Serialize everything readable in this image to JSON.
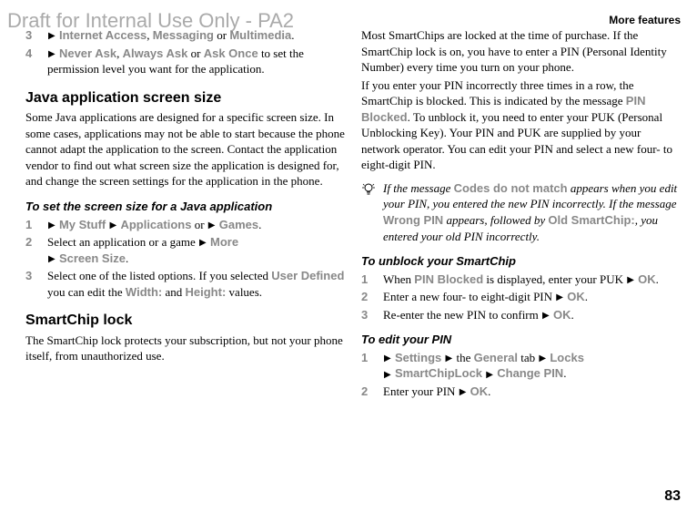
{
  "watermark": "Draft for Internal Use Only - PA2",
  "headerRight": "More features",
  "pageNum": "83",
  "left": {
    "step3num": "3",
    "step3_arrow": "▶",
    "step3_t1": "Internet Access",
    "step3_sep1": ", ",
    "step3_t2": "Messaging",
    "step3_sep2": " or ",
    "step3_t3": "Multimedia",
    "step3_end": ".",
    "step4num": "4",
    "step4_t1": "Never Ask",
    "step4_sep1": ", ",
    "step4_t2": "Always Ask",
    "step4_sep2": " or ",
    "step4_t3": "Ask Once",
    "step4_body": " to set the permission level you want for the application.",
    "h_java": "Java application screen size",
    "p_java": "Some Java applications are designed for a specific screen size. In some cases, applications may not be able to start because the phone cannot adapt the application to the screen. Contact the application vendor to find out what screen size the application is designed for, and change the screen settings for the application in the phone.",
    "h_setscreen": "To set the screen size for a Java application",
    "ss1num": "1",
    "ss1_t1": "My Stuff",
    "ss1_t2": "Applications",
    "ss1_sep": " or ",
    "ss1_t3": "Games",
    "ss1_end": ".",
    "ss2num": "2",
    "ss2_body1": "Select an application or a game ",
    "ss2_t1": "More",
    "ss2_t2": "Screen Size",
    "ss2_end": ".",
    "ss3num": "3",
    "ss3_body1": "Select one of the listed options. If you selected ",
    "ss3_t1": "User Defined",
    "ss3_body2": " you can edit the ",
    "ss3_t2": "Width:",
    "ss3_body3": " and ",
    "ss3_t3": "Height:",
    "ss3_body4": " values.",
    "h_smartchip": "SmartChip lock",
    "p_smartchip": "The SmartChip lock protects your subscription, but not your phone itself, from unauthorized use."
  },
  "right": {
    "p1a": "Most SmartChips are locked at the time of purchase. If the SmartChip lock is on, you have to enter a PIN (Personal Identity Number) every time you turn on your phone.",
    "p1b1": "If you enter your PIN incorrectly three times in a row, the SmartChip is blocked. This is indicated by the message ",
    "p1b_t1": "PIN Blocked",
    "p1b2": ". To unblock it, you need to enter your PUK (Personal Unblocking Key). Your PIN and PUK are supplied by your network operator. You can edit your PIN and select a new four- to eight-digit PIN.",
    "tip_a": "If the message ",
    "tip_t1": "Codes do not match",
    "tip_b": " appears when you edit your PIN, you entered the new PIN incorrectly. If the message ",
    "tip_t2": "Wrong PIN",
    "tip_c": " appears, followed by ",
    "tip_t3": "Old SmartChip:",
    "tip_d": ", you entered your old PIN incorrectly.",
    "h_unblock": "To unblock your SmartChip",
    "ub1num": "1",
    "ub1_a": "When ",
    "ub1_t1": "PIN Blocked",
    "ub1_b": " is displayed, enter your PUK ",
    "ub1_t2": "OK",
    "ub1_end": ".",
    "ub2num": "2",
    "ub2_a": "Enter a new four- to eight-digit PIN ",
    "ub2_t1": "OK",
    "ub2_end": ".",
    "ub3num": "3",
    "ub3_a": "Re-enter the new PIN to confirm ",
    "ub3_t1": "OK",
    "ub3_end": ".",
    "h_editpin": "To edit your PIN",
    "ep1num": "1",
    "ep1_t1": "Settings",
    "ep1_a": " the ",
    "ep1_t2": "General",
    "ep1_b": " tab ",
    "ep1_t3": "Locks",
    "ep1_t4": "SmartChipLock",
    "ep1_t5": "Change PIN",
    "ep1_end": ".",
    "ep2num": "2",
    "ep2_a": "Enter your PIN ",
    "ep2_t1": "OK",
    "ep2_end": "."
  }
}
